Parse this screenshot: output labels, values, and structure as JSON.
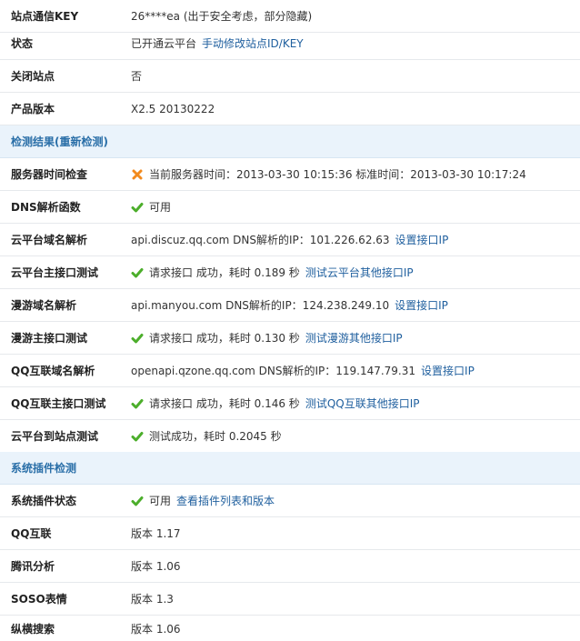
{
  "rows_top": [
    {
      "key": "站点通信KEY",
      "value": "26****ea (出于安全考虑，部分隐藏)"
    },
    {
      "key": "状态",
      "value": "已开通云平台",
      "link": "手动修改站点ID/KEY"
    },
    {
      "key": "关闭站点",
      "value": "否"
    },
    {
      "key": "产品版本",
      "value": "X2.5 20130222"
    }
  ],
  "section_detect": {
    "title": "检测结果",
    "recheck": "(重新检测)"
  },
  "detect_rows": [
    {
      "key": "服务器时间检查",
      "status": "error",
      "value": "当前服务器时间：2013-03-30 10:15:36 标准时间：2013-03-30 10:17:24"
    },
    {
      "key": "DNS解析函数",
      "status": "ok",
      "value": "可用"
    },
    {
      "key": "云平台域名解析",
      "value": "api.discuz.qq.com DNS解析的IP：101.226.62.63",
      "link": "设置接口IP"
    },
    {
      "key": "云平台主接口测试",
      "status": "ok",
      "value": "请求接口 成功，耗时 0.189 秒",
      "link": "测试云平台其他接口IP"
    },
    {
      "key": "漫游域名解析",
      "value": "api.manyou.com DNS解析的IP：124.238.249.10",
      "link": "设置接口IP"
    },
    {
      "key": "漫游主接口测试",
      "status": "ok",
      "value": "请求接口 成功，耗时 0.130 秒",
      "link": "测试漫游其他接口IP"
    },
    {
      "key": "QQ互联域名解析",
      "value": "openapi.qzone.qq.com DNS解析的IP：119.147.79.31",
      "link": "设置接口IP"
    },
    {
      "key": "QQ互联主接口测试",
      "status": "ok",
      "value": "请求接口 成功，耗时 0.146 秒",
      "link": "测试QQ互联其他接口IP"
    },
    {
      "key": "云平台到站点测试",
      "status": "ok",
      "value": "测试成功，耗时 0.2045 秒"
    }
  ],
  "section_plugins": {
    "title": "系统插件检测"
  },
  "plugin_rows": [
    {
      "key": "系统插件状态",
      "status": "ok",
      "value": "可用",
      "link": "查看插件列表和版本"
    },
    {
      "key": "QQ互联",
      "value": "版本 1.17"
    },
    {
      "key": "腾讯分析",
      "value": "版本 1.06"
    },
    {
      "key": "SOSO表情",
      "value": "版本 1.3"
    },
    {
      "key": "纵横搜索",
      "value": "版本 1.06"
    }
  ],
  "colors": {
    "ok": "#4cae2b",
    "error": "#f28a1d",
    "link": "#1f5f9e",
    "section_bg": "#eaf3fb",
    "section_text": "#2a6fa8"
  },
  "icons": {
    "ok": "check-icon",
    "error": "cross-icon"
  }
}
